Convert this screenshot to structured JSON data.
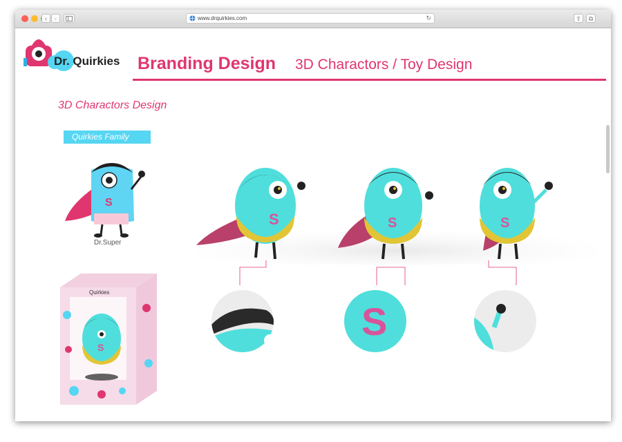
{
  "browser": {
    "url": "www.drquirkies.com",
    "icons": [
      "back-icon",
      "forward-icon",
      "sidebar-icon",
      "reload-icon",
      "share-icon",
      "tabs-icon"
    ]
  },
  "brand": {
    "logo_text": "Dr. Quirkies"
  },
  "header": {
    "title": "Branding Design",
    "subtitle": "3D Charactors / Toy Design"
  },
  "section": {
    "title": "3D Charactors Design",
    "tag": "Quirkies Family"
  },
  "character": {
    "name": "Dr.Super",
    "chest_letter": "S"
  },
  "package": {
    "brand_label": "Quirkies"
  },
  "colors": {
    "accent": "#e0366f",
    "tag_bg": "#55d6f2",
    "body": "#4fdedc",
    "shorts": "#e2c536",
    "cape": "#c1456c"
  }
}
